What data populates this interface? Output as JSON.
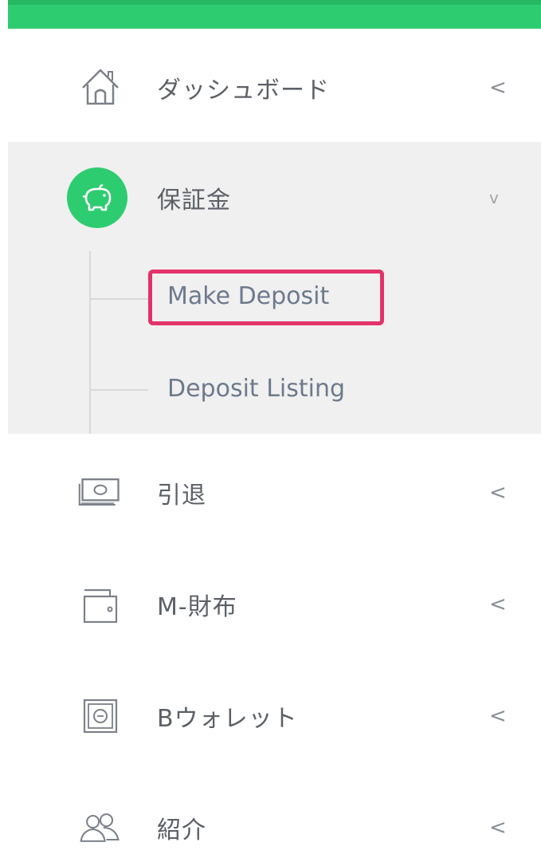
{
  "menu": {
    "dashboard": {
      "label": "ダッシュボード",
      "chevron": "<",
      "icon": "home-icon"
    },
    "deposit": {
      "label": "保証金",
      "chevron": "v",
      "icon": "piggy-bank-icon",
      "sub_items": [
        {
          "label": "Make Deposit"
        },
        {
          "label": "Deposit Listing"
        }
      ]
    },
    "withdraw": {
      "label": "引退",
      "chevron": "<",
      "icon": "money-icon"
    },
    "mwallet": {
      "label": "M-財布",
      "chevron": "<",
      "icon": "wallet-icon"
    },
    "bwallet": {
      "label": "Bウォレット",
      "chevron": "<",
      "icon": "safe-icon"
    },
    "referral": {
      "label": "紹介",
      "chevron": "<",
      "icon": "users-icon"
    }
  },
  "colors": {
    "accent": "#2ecc71",
    "highlight": "#e3326a",
    "section_bg": "#f0f0f0"
  }
}
